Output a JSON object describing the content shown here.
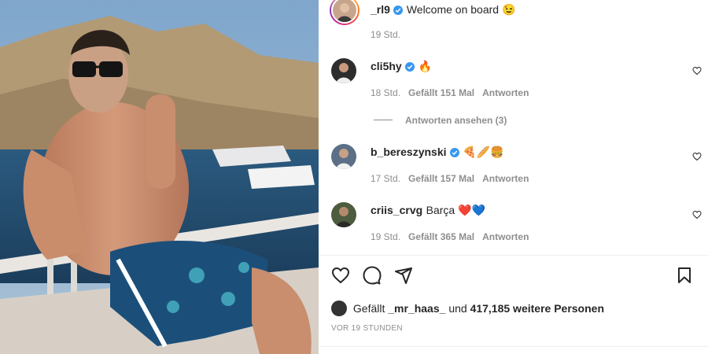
{
  "comments": [
    {
      "user": "_rl9",
      "text": "Welcome on board 😉",
      "time": "19 Std.",
      "verified": true
    },
    {
      "user": "cli5hy",
      "text": "🔥",
      "time": "18 Std.",
      "likes": "Gefällt 151 Mal",
      "reply": "Antworten",
      "verified": true
    },
    {
      "user": "b_bereszynski",
      "text": "🍕🥖🍔",
      "time": "17 Std.",
      "likes": "Gefällt 157 Mal",
      "reply": "Antworten",
      "verified": true
    },
    {
      "user": "criis_crvg",
      "text": "Barça ❤️💙",
      "time": "19 Std.",
      "likes": "Gefällt 365 Mal",
      "reply": "Antworten",
      "verified": false
    }
  ],
  "view_replies": "Antworten ansehen (3)",
  "likes": {
    "prefix": "Gefällt",
    "user": "_mr_haas_",
    "middle": "und",
    "count": "417,185 weitere Personen"
  },
  "post_time": "VOR 19 STUNDEN",
  "icons": {
    "like": "heart-icon",
    "comment": "comment-icon",
    "share": "share-icon",
    "save": "bookmark-icon"
  }
}
